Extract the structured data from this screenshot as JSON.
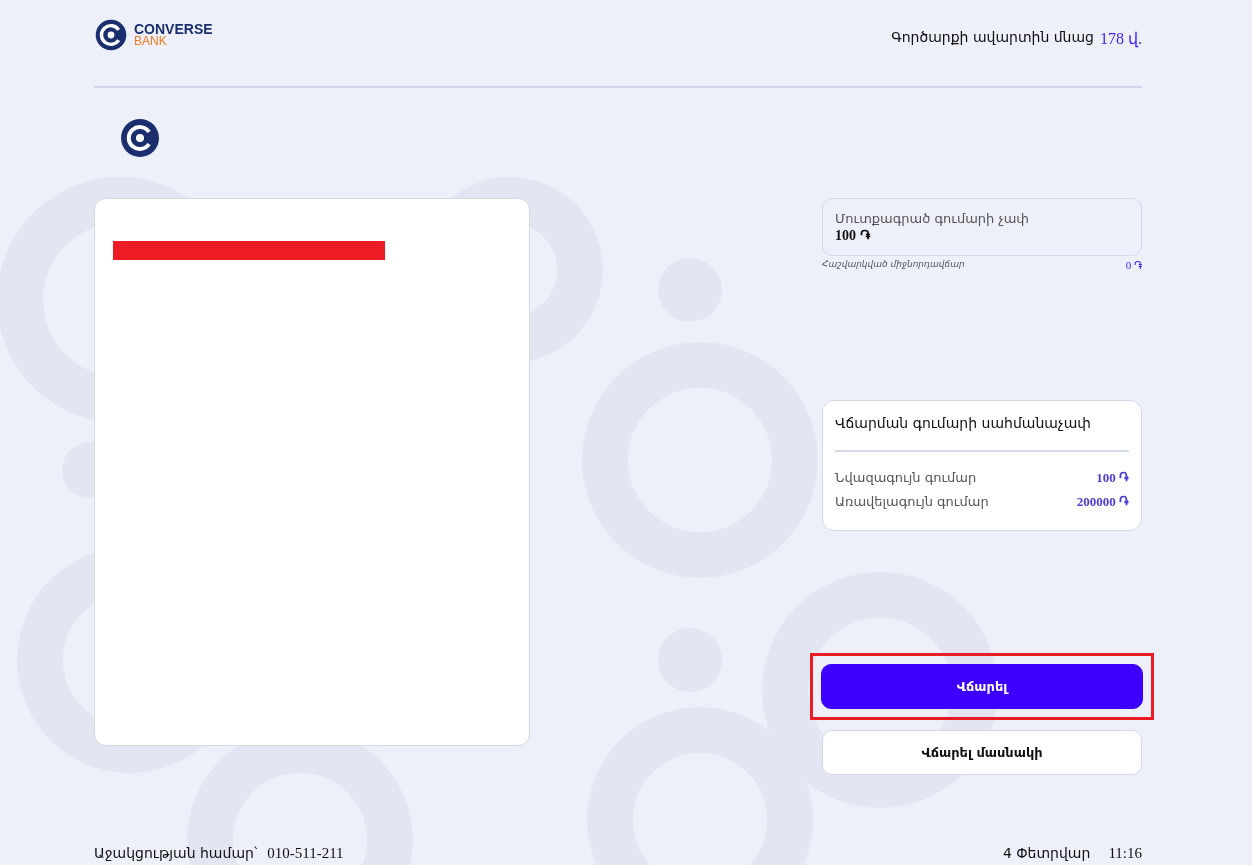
{
  "header": {
    "logo": {
      "name": "CONVERSE",
      "sub": "BANK"
    },
    "timer": {
      "label": "Գործարքի ավարտին մնաց",
      "value": "178 վ."
    }
  },
  "amount_field": {
    "label": "Մուտքագրած գումարի չափ",
    "value": "100 ֏"
  },
  "commission": {
    "label": "Հաշվարկված միջնորդավճար",
    "value": "0 ֏"
  },
  "limits": {
    "title": "Վճարման գումարի սահմանաչափ",
    "rows": [
      {
        "label": "Նվազագույն գումար",
        "value": "100 ֏"
      },
      {
        "label": "Առավելագույն գումար",
        "value": "200000 ֏"
      }
    ]
  },
  "buttons": [
    {
      "label": "Վճարել",
      "kind": "primary",
      "highlighted": true
    },
    {
      "label": "Վճարել մասնակի",
      "kind": "secondary",
      "highlighted": false
    }
  ],
  "footer": {
    "support_label": "Աջակցության համար՝",
    "support_phone": "010-511-211",
    "date": "4 Փետրվար",
    "time": "11:16"
  }
}
